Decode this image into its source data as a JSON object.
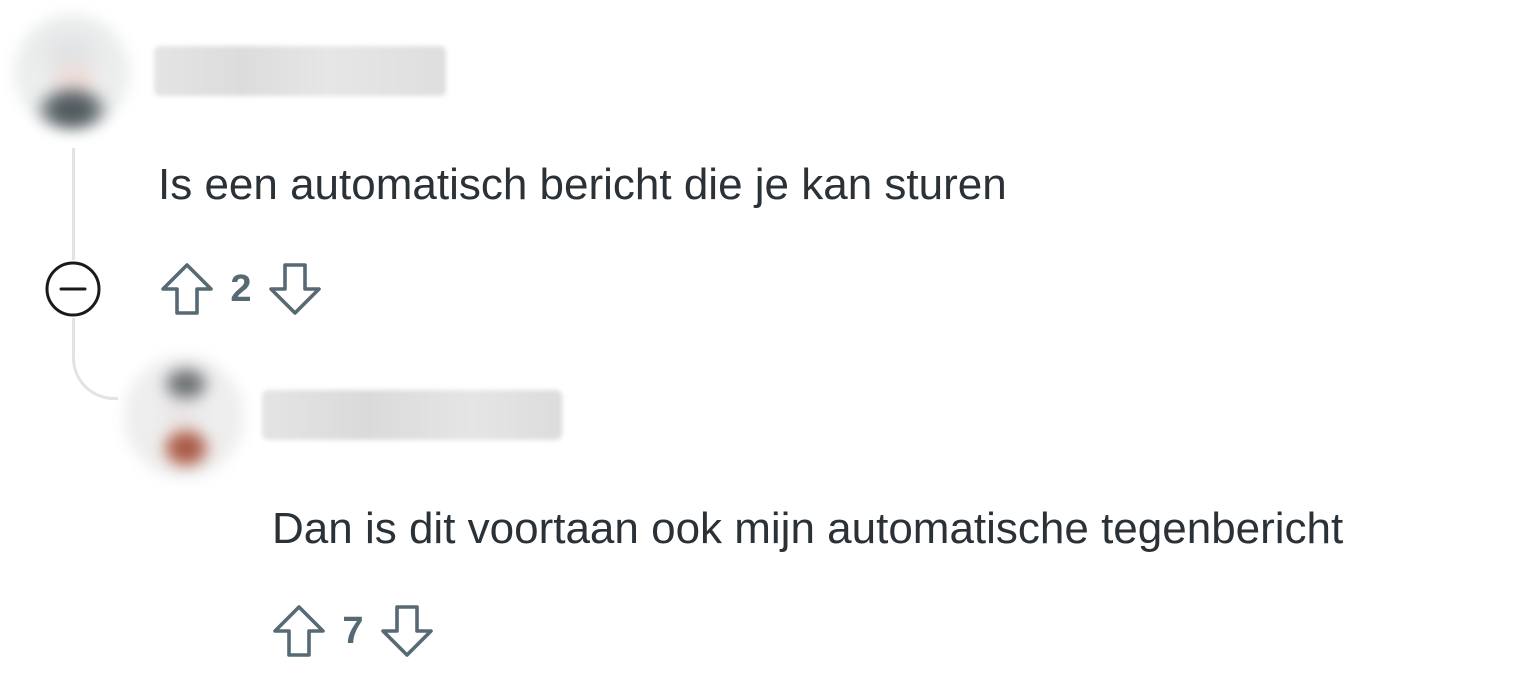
{
  "thread": {
    "comments": [
      {
        "username": "",
        "body": "Is een automatisch bericht die je kan sturen",
        "score": "2"
      },
      {
        "username": "",
        "body": "Dan is dit voortaan ook mijn automatische tegenbericht",
        "score": "7"
      }
    ]
  },
  "icons": {
    "collapse": "minus-circle-icon",
    "upvote": "arrow-up-icon",
    "downvote": "arrow-down-icon"
  },
  "colors": {
    "text": "#2a3137",
    "vote_icon": "#576a74",
    "thread_line": "#e1e3e5"
  }
}
